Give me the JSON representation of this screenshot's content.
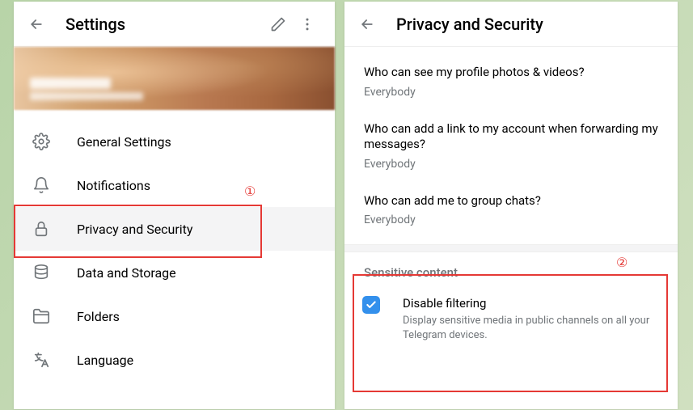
{
  "settings": {
    "title": "Settings",
    "menu": [
      {
        "key": "general",
        "label": "General Settings",
        "icon": "gear-icon"
      },
      {
        "key": "notifications",
        "label": "Notifications",
        "icon": "bell-icon"
      },
      {
        "key": "privacy",
        "label": "Privacy and Security",
        "icon": "lock-icon",
        "selected": true
      },
      {
        "key": "data",
        "label": "Data and Storage",
        "icon": "database-icon"
      },
      {
        "key": "folders",
        "label": "Folders",
        "icon": "folder-icon"
      },
      {
        "key": "language",
        "label": "Language",
        "icon": "language-icon"
      }
    ]
  },
  "privacy": {
    "title": "Privacy and Security",
    "items": [
      {
        "question": "Who can see my profile photos & videos?",
        "value": "Everybody"
      },
      {
        "question": "Who can add a link to my account when forwarding my messages?",
        "value": "Everybody"
      },
      {
        "question": "Who can add me to group chats?",
        "value": "Everybody"
      }
    ],
    "sensitive": {
      "section_title": "Sensitive content",
      "check_label": "Disable filtering",
      "check_desc": "Display sensitive media in public channels on all your Telegram devices.",
      "checked": true
    }
  },
  "annotations": {
    "marker1": "①",
    "marker2": "②"
  }
}
